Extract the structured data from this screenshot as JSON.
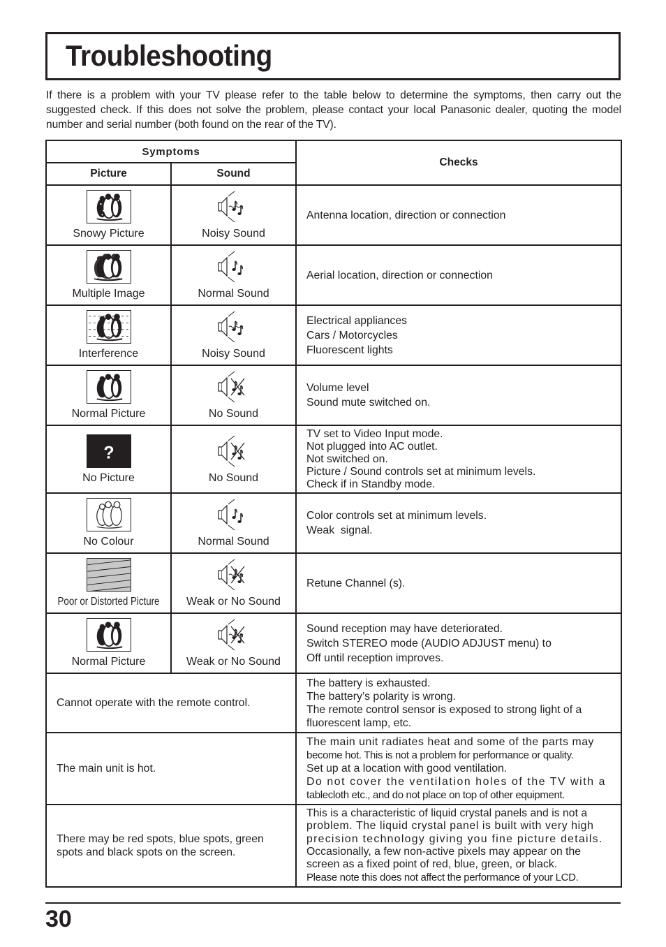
{
  "page": {
    "title": "Troubleshooting",
    "intro": "If there is a problem with your TV please refer to the table below to determine the symptoms, then carry out the suggested check. If this does not solve the problem, please contact your local Panasonic dealer, quoting the model number and serial number (both found on the rear of the TV).",
    "page_number": "30"
  },
  "table": {
    "headers": {
      "symptoms": "Symptoms",
      "picture": "Picture",
      "sound": "Sound",
      "checks": "Checks"
    },
    "rows": [
      {
        "picture": {
          "label": "Snowy Picture",
          "icon": "snowy-picture-icon"
        },
        "sound": {
          "label": "Noisy Sound",
          "icon": "noisy-sound-icon"
        },
        "checks": [
          "Antenna location, direction or connection"
        ]
      },
      {
        "picture": {
          "label": "Multiple Image",
          "icon": "multiple-image-icon"
        },
        "sound": {
          "label": "Normal Sound",
          "icon": "normal-sound-icon"
        },
        "checks": [
          "Aerial location, direction or connection"
        ]
      },
      {
        "picture": {
          "label": "Interference",
          "icon": "interference-picture-icon"
        },
        "sound": {
          "label": "Noisy Sound",
          "icon": "noisy-sound-icon"
        },
        "checks": [
          "Electrical appliances",
          "Cars / Motorcycles",
          "Fluorescent lights"
        ]
      },
      {
        "picture": {
          "label": "Normal Picture",
          "icon": "normal-picture-icon"
        },
        "sound": {
          "label": "No Sound",
          "icon": "no-sound-icon"
        },
        "checks": [
          "Volume level",
          "Sound mute switched on."
        ]
      },
      {
        "picture": {
          "label": "No Picture",
          "icon": "no-picture-icon",
          "glyph": "?"
        },
        "sound": {
          "label": "No Sound",
          "icon": "no-sound-icon"
        },
        "checks": [
          "TV set to Video Input mode.",
          "Not plugged into AC outlet.",
          "Not switched on.",
          "Picture / Sound controls set at minimum levels.",
          "Check if in Standby mode."
        ]
      },
      {
        "picture": {
          "label": "No Colour",
          "icon": "no-colour-picture-icon"
        },
        "sound": {
          "label": "Normal Sound",
          "icon": "normal-sound-icon"
        },
        "checks": [
          "Color controls set at minimum levels.",
          "Weak  signal."
        ]
      },
      {
        "picture": {
          "label": "Poor or Distorted Picture",
          "icon": "distorted-picture-icon"
        },
        "sound": {
          "label": "Weak or No Sound",
          "icon": "weak-sound-icon"
        },
        "checks": [
          "Retune Channel (s)."
        ]
      },
      {
        "picture": {
          "label": "Normal Picture",
          "icon": "normal-picture-icon"
        },
        "sound": {
          "label": "Weak or No Sound",
          "icon": "weak-sound-icon"
        },
        "checks": [
          "Sound reception may have deteriorated.",
          "Switch STEREO mode (AUDIO ADJUST menu) to",
          "Off until reception improves."
        ]
      }
    ],
    "merged_rows": [
      {
        "symptom": "Cannot operate with the remote control.",
        "checks": [
          "The battery is exhausted.",
          "The battery’s polarity is wrong.",
          "The remote control sensor is exposed to strong light of a",
          "fluorescent lamp, etc."
        ]
      },
      {
        "symptom": "The main unit is hot.",
        "checks": [
          "The main unit radiates heat and some of the parts may",
          "become hot. This is not a problem for performance or quality.",
          "Set up at a location with good ventilation.",
          "Do not cover the ventilation holes of the TV with a",
          "tablecloth etc., and do not place on top of other equipment."
        ]
      },
      {
        "symptom": "There may be red spots, blue spots, green spots and black spots on the screen.",
        "checks": [
          "This is a characteristic of liquid crystal panels and is not a",
          "problem. The liquid crystal panel is built with very high",
          "precision technology giving you fine picture details.",
          "Occasionally, a few non-active pixels may appear on the",
          "screen as a fixed point of red, blue, green, or black.",
          "Please note this does not affect the performance of your LCD."
        ]
      }
    ]
  }
}
